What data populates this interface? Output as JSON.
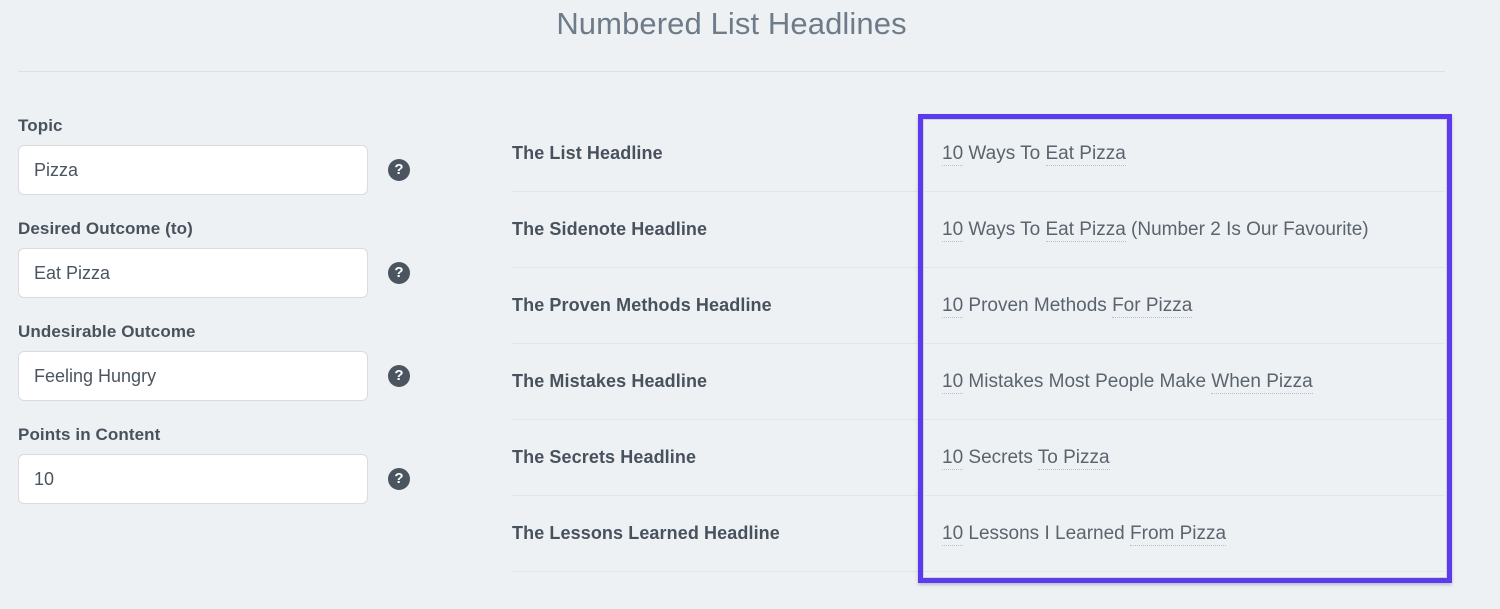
{
  "page": {
    "title": "Numbered List Headlines",
    "accent_color": "#5c3bef",
    "background_color": "#eef1f4",
    "label_color": "#48525d"
  },
  "form": {
    "fields": [
      {
        "label": "Topic",
        "value": "Pizza",
        "placeholder": "Topic",
        "help_icon": "question-mark-circle-icon",
        "help_glyph": "?"
      },
      {
        "label": "Desired Outcome (to)",
        "value": "Eat Pizza",
        "placeholder": "Desired Outcome",
        "help_icon": "question-mark-circle-icon",
        "help_glyph": "?"
      },
      {
        "label": "Undesirable Outcome",
        "value": "Feeling Hungry",
        "placeholder": "Undesirable Outcome",
        "help_icon": "question-mark-circle-icon",
        "help_glyph": "?"
      },
      {
        "label": "Points in Content",
        "value": "10",
        "placeholder": "Points in Content",
        "help_icon": "question-mark-circle-icon",
        "help_glyph": "?"
      }
    ]
  },
  "results": {
    "rows": [
      {
        "label": "The List Headline",
        "value": "10 Ways To Eat Pizza",
        "parts": [
          {
            "text": "10",
            "spellcheck": true
          },
          {
            "text": " Ways To ",
            "spellcheck": false
          },
          {
            "text": "Eat Pizza",
            "spellcheck": true
          }
        ]
      },
      {
        "label": "The Sidenote Headline",
        "value": "10 Ways To Eat Pizza (Number 2 Is Our Favourite)",
        "parts": [
          {
            "text": "10",
            "spellcheck": true
          },
          {
            "text": " Ways To ",
            "spellcheck": false
          },
          {
            "text": "Eat Pizza",
            "spellcheck": true
          },
          {
            "text": " (Number 2 Is Our Favourite)",
            "spellcheck": false
          }
        ]
      },
      {
        "label": "The Proven Methods Headline",
        "value": "10 Proven Methods For Pizza",
        "parts": [
          {
            "text": "10",
            "spellcheck": true
          },
          {
            "text": " Proven Methods ",
            "spellcheck": false
          },
          {
            "text": "For Pizza",
            "spellcheck": true
          }
        ]
      },
      {
        "label": "The Mistakes Headline",
        "value": "10 Mistakes Most People Make When Pizza",
        "parts": [
          {
            "text": "10",
            "spellcheck": true
          },
          {
            "text": " Mistakes Most People Make ",
            "spellcheck": false
          },
          {
            "text": "When Pizza",
            "spellcheck": true
          }
        ]
      },
      {
        "label": "The Secrets Headline",
        "value": "10 Secrets To Pizza",
        "parts": [
          {
            "text": "10",
            "spellcheck": true
          },
          {
            "text": " Secrets ",
            "spellcheck": false
          },
          {
            "text": "To Pizza",
            "spellcheck": true
          }
        ]
      },
      {
        "label": "The Lessons Learned Headline",
        "value": "10 Lessons I Learned From Pizza",
        "parts": [
          {
            "text": "10",
            "spellcheck": true
          },
          {
            "text": " Lessons I Learned ",
            "spellcheck": false
          },
          {
            "text": "From Pizza",
            "spellcheck": true
          }
        ]
      }
    ]
  }
}
